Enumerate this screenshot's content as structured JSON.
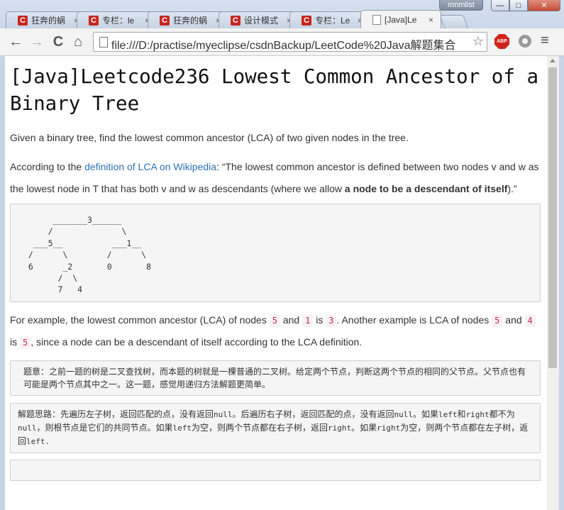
{
  "window": {
    "user_badge": "mnmlist",
    "minimize": "—",
    "maximize": "□",
    "close": "✕"
  },
  "tabs": [
    {
      "title": "狂奔的蜗",
      "icon": "C",
      "active": false
    },
    {
      "title": "专栏：le",
      "icon": "C",
      "active": false
    },
    {
      "title": "狂奔的蜗",
      "icon": "C",
      "active": false
    },
    {
      "title": "设计模式",
      "icon": "C",
      "active": false
    },
    {
      "title": "专栏：Le",
      "icon": "C",
      "active": false
    },
    {
      "title": "[Java]Le",
      "icon": "page",
      "active": true
    }
  ],
  "toolbar": {
    "back": "←",
    "forward": "→",
    "reload": "C",
    "home": "⌂",
    "url": "file:///D:/practise/myeclipse/csdnBackup/LeetCode%20Java解题集合",
    "star": "☆",
    "abp_label": "ABP",
    "menu": "≡"
  },
  "page": {
    "title": "[Java]Leetcode236 Lowest Common Ancestor of a Binary Tree",
    "intro": "Given a binary tree, find the lowest common ancestor (LCA) of two given nodes in the tree.",
    "p2_before": "According to the ",
    "p2_link": "definition of LCA on Wikipedia",
    "p2_after": ": “The lowest common ancestor is defined between two nodes v and w as the lowest node in T that has both v and w as descendants (where we allow ",
    "p2_bold": "a node to be a descendant of itself",
    "p2_end": ").”",
    "tree_ascii": "      _______3______\n     /              \\\n  ___5__          ___1__\n /      \\        /      \\\n 6      _2       0       8\n       /  \\\n       7   4",
    "ex_1": "For example, the lowest common ancestor (LCA) of nodes ",
    "ex_code1": "5",
    "ex_2": " and ",
    "ex_code2": "1",
    "ex_3": " is ",
    "ex_code3": "3",
    "ex_4": ". Another example is LCA of nodes ",
    "ex_code4": "5",
    "ex_5": " and ",
    "ex_code5": "4",
    "ex_6": " is ",
    "ex_code6": "5",
    "ex_7": ", since a node can be a descendant of itself according to the LCA definition.",
    "note1": "题意：之前一题的树是二叉查找树，而本题的树就是一棵普通的二叉树。给定两个节点，判断这两个节点的相同的父节点。父节点也有可能是两个节点其中之一。这一题，感觉用递归方法解题更简单。",
    "n2_a": "解题思路：先遍历左子树，返回匹配的点，没有返回",
    "n2_null1": "null",
    "n2_b": "。后遍历右子树，返回匹配的点，没有返回",
    "n2_null2": "null",
    "n2_c": "。如果",
    "n2_left1": "left",
    "n2_d": "和",
    "n2_right1": "right",
    "n2_e": "都不为",
    "n2_null3": "null",
    "n2_f": "，则根节点是它们的共同节点。如果",
    "n2_left2": "left",
    "n2_g": "为空，则两个节点都在右子树，返回",
    "n2_right2": "right",
    "n2_h": "。如果",
    "n2_right3": "right",
    "n2_i": "为空，则两个节点都在左子树，返回",
    "n2_left3": "left",
    "n2_j": "."
  }
}
